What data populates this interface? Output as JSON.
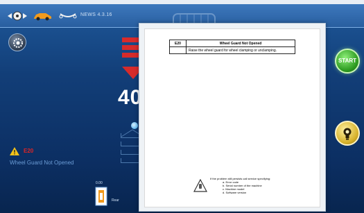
{
  "topbar": {
    "version": "NEWS  4.3.16",
    "icons": [
      "wheel-balance-icon",
      "car-icon",
      "motorbike-icon"
    ]
  },
  "left_panel": {
    "settings_icon": "gear-icon",
    "warning_code": "E20",
    "warning_message": "Wheel Guard Not Opened"
  },
  "center": {
    "value": "40"
  },
  "bottom": {
    "small_value": "0.00",
    "label": "Rear"
  },
  "right": {
    "start_label": "START",
    "light_icon": "bulb-icon"
  },
  "dialog": {
    "error_code": "E20",
    "error_title": "Wheel Guard Not Opened",
    "error_action": "Raise the wheel guard for wheel clamping or unclamping.",
    "footer_intro": "If the problem still persists call service specifying:",
    "footer_items": [
      "a.   Error code",
      "b.   Serial number of the machine",
      "c.   Machine model",
      "d.   Software version"
    ]
  },
  "colors": {
    "accent_red": "#d62b2b",
    "start_green": "#2c9a20",
    "bulb_yellow": "#d6b12a",
    "warning_red": "#e22424"
  }
}
